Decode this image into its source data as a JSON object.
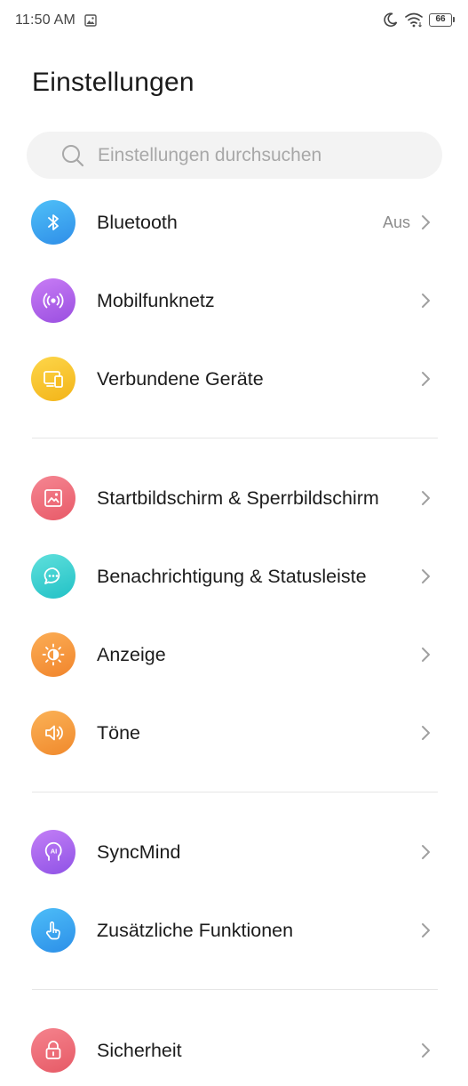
{
  "status_bar": {
    "time": "11:50 AM",
    "battery": "66"
  },
  "title": "Einstellungen",
  "search": {
    "placeholder": "Einstellungen durchsuchen"
  },
  "colors": {
    "bluetooth": "#37a8f0",
    "mobile": "#b063e8",
    "devices": "#f7c42a",
    "homescreen": "#ee6d79",
    "notifications": "#3fd2d2",
    "display": "#f59a3d",
    "sounds": "#f6a13c",
    "syncmind": "#a567ec",
    "extra": "#3aa9f2",
    "security": "#ee6a74"
  },
  "groups": [
    {
      "items": [
        {
          "id": "bluetooth",
          "label": "Bluetooth",
          "value": "Aus",
          "icon": "bluetooth-icon"
        },
        {
          "id": "mobile",
          "label": "Mobilfunknetz",
          "icon": "cellular-signal-icon"
        },
        {
          "id": "devices",
          "label": "Verbundene Geräte",
          "icon": "devices-icon"
        }
      ]
    },
    {
      "items": [
        {
          "id": "homescreen",
          "label": "Startbildschirm & Sperrbildschirm",
          "icon": "wallpaper-icon"
        },
        {
          "id": "notifications",
          "label": "Benachrichtigung & Statusleiste",
          "icon": "chat-bubble-icon"
        },
        {
          "id": "display",
          "label": "Anzeige",
          "icon": "brightness-icon"
        },
        {
          "id": "sounds",
          "label": "Töne",
          "icon": "speaker-icon"
        }
      ]
    },
    {
      "items": [
        {
          "id": "syncmind",
          "label": "SyncMind",
          "icon": "ai-head-icon"
        },
        {
          "id": "extra",
          "label": "Zusätzliche Funktionen",
          "icon": "hand-tap-icon"
        }
      ]
    },
    {
      "items": [
        {
          "id": "security",
          "label": "Sicherheit",
          "icon": "lock-icon"
        }
      ]
    }
  ]
}
